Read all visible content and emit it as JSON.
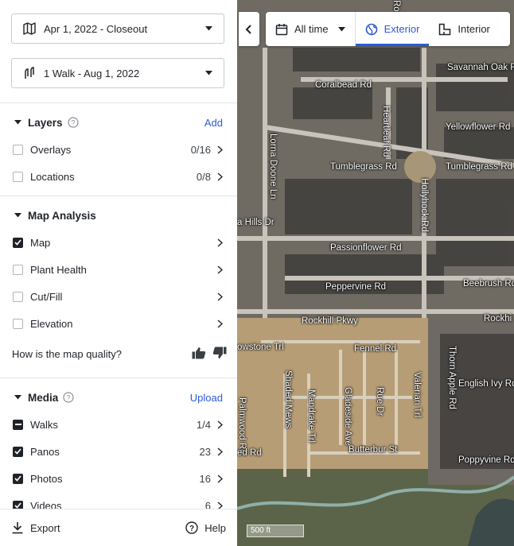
{
  "sidebar": {
    "date_select": "Apr 1, 2022 - Closeout",
    "walk_select": "1 Walk - Aug 1, 2022",
    "layers": {
      "title": "Layers",
      "action": "Add",
      "items": [
        {
          "label": "Overlays",
          "count": "0/16",
          "checked": false
        },
        {
          "label": "Locations",
          "count": "0/8",
          "checked": false
        }
      ]
    },
    "analysis": {
      "title": "Map Analysis",
      "items": [
        {
          "label": "Map",
          "checked": true
        },
        {
          "label": "Plant Health",
          "checked": false
        },
        {
          "label": "Cut/Fill",
          "checked": false
        },
        {
          "label": "Elevation",
          "checked": false
        }
      ],
      "quality_question": "How is the map quality?"
    },
    "media": {
      "title": "Media",
      "action": "Upload",
      "items": [
        {
          "label": "Walks",
          "count": "1/4",
          "state": "partial"
        },
        {
          "label": "Panos",
          "count": "23",
          "state": "checked"
        },
        {
          "label": "Photos",
          "count": "16",
          "state": "checked"
        },
        {
          "label": "Videos",
          "count": "6",
          "state": "checked"
        }
      ]
    },
    "footer": {
      "export": "Export",
      "help": "Help"
    }
  },
  "toolbar": {
    "time": "All time",
    "exterior": "Exterior",
    "interior": "Interior"
  },
  "map": {
    "scale": "500 ft",
    "streets": [
      "Coralbead Rd",
      "Savannah Oak Rd",
      "Heartleaf Rd",
      "Yellowflower Rd",
      "Lorna Doone Ln",
      "Tumblegrass Rd",
      "Tumblegrass Rd",
      "Hollyhock Rd",
      "a Hills Dr",
      "Passionflower Rd",
      "Beebrush Rd",
      "Peppervine Rd",
      "Rockhill Pkwy",
      "Rockhi",
      "owstone Trl",
      "Fennel Rd",
      "Thorn Apple Rd",
      "Valerian Trl",
      "English Ivy Rd",
      "Shaded Mews",
      "Mandrake Trl",
      "Gladeside Ave",
      "Rue Dr",
      "Palmwood Rd",
      "Butterbur St",
      "ed Rd",
      "Poppyvine Rd",
      "Ro"
    ]
  },
  "colors": {
    "accent": "#2a5bd7"
  }
}
